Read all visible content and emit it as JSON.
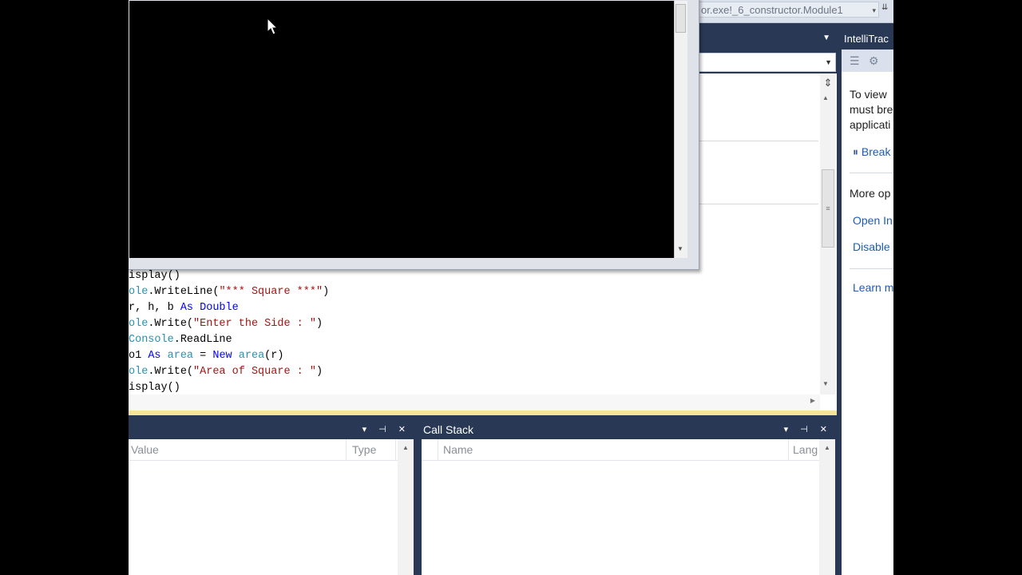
{
  "nav": {
    "combo_text": "or.exe!_6_constructor.Module1",
    "dropdown_glyph": "▾",
    "overflow_glyph": "⇊"
  },
  "editor": {
    "lines": [
      [
        {
          "t": "isplay()",
          "c": "plain"
        }
      ],
      [
        {
          "t": "ole",
          "c": "ty"
        },
        {
          "t": ".WriteLine(",
          "c": "plain"
        },
        {
          "t": "\"*** Square ***\"",
          "c": "str"
        },
        {
          "t": ")",
          "c": "plain"
        }
      ],
      [
        {
          "t": "r, h, b ",
          "c": "plain"
        },
        {
          "t": "As",
          "c": "kw"
        },
        {
          "t": " ",
          "c": "plain"
        },
        {
          "t": "Double",
          "c": "kw"
        }
      ],
      [
        {
          "t": "ole",
          "c": "ty"
        },
        {
          "t": ".Write(",
          "c": "plain"
        },
        {
          "t": "\"Enter the Side : \"",
          "c": "str"
        },
        {
          "t": ")",
          "c": "plain"
        }
      ],
      [
        {
          "t": "Console",
          "c": "ty"
        },
        {
          "t": ".ReadLine",
          "c": "plain"
        }
      ],
      [
        {
          "t": "o1 ",
          "c": "plain"
        },
        {
          "t": "As",
          "c": "kw"
        },
        {
          "t": " ",
          "c": "plain"
        },
        {
          "t": "area",
          "c": "ty"
        },
        {
          "t": " = ",
          "c": "plain"
        },
        {
          "t": "New",
          "c": "kw"
        },
        {
          "t": " ",
          "c": "plain"
        },
        {
          "t": "area",
          "c": "ty"
        },
        {
          "t": "(r)",
          "c": "plain"
        }
      ],
      [
        {
          "t": "ole",
          "c": "ty"
        },
        {
          "t": ".Write(",
          "c": "plain"
        },
        {
          "t": "\"Area of Square : \"",
          "c": "str"
        },
        {
          "t": ")",
          "c": "plain"
        }
      ],
      [
        {
          "t": "isplay()",
          "c": "plain"
        }
      ]
    ],
    "splitter_glyph": "⇕",
    "scroll_grip": "≡"
  },
  "locals_panel": {
    "tools": "▾ ⊣ ✕",
    "col_value": "Value",
    "col_type": "Type"
  },
  "callstack_panel": {
    "title": "Call Stack",
    "tools": "▾ ⊣ ✕",
    "col_name": "Name",
    "col_lang": "Lang"
  },
  "intellitrace": {
    "title": "IntelliTrac",
    "toolbar_icons": [
      "list-icon",
      "settings-icon"
    ],
    "text_line1": "To view",
    "text_line2": "must bre",
    "text_line3": "applicati",
    "break_link": "Break",
    "break_glyph": "⏸",
    "more_options": "More op",
    "open_link": "Open In",
    "disable_link": "Disable",
    "learn_link": "Learn m"
  }
}
